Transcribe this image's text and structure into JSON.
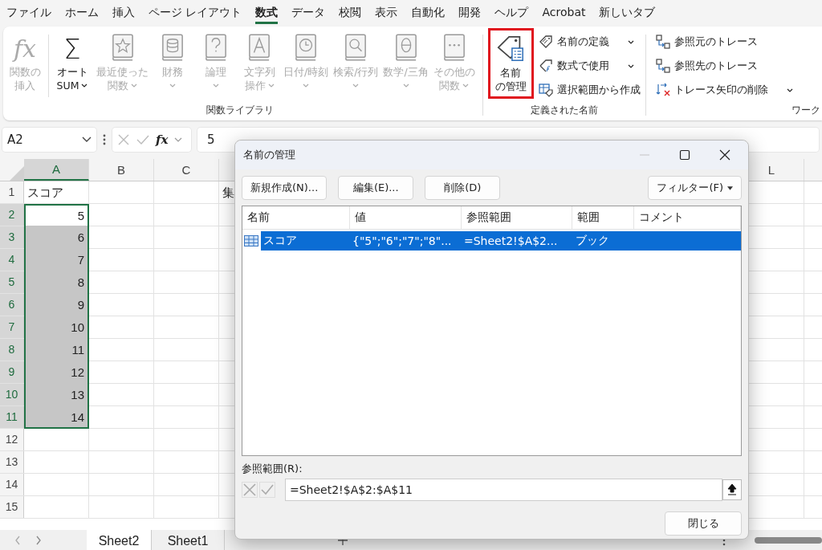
{
  "menu_tabs": [
    {
      "label": "ファイル",
      "selected": false
    },
    {
      "label": "ホーム",
      "selected": false
    },
    {
      "label": "挿入",
      "selected": false
    },
    {
      "label": "ページ レイアウト",
      "selected": false
    },
    {
      "label": "数式",
      "selected": true
    },
    {
      "label": "データ",
      "selected": false
    },
    {
      "label": "校閲",
      "selected": false
    },
    {
      "label": "表示",
      "selected": false
    },
    {
      "label": "自動化",
      "selected": false
    },
    {
      "label": "開発",
      "selected": false
    },
    {
      "label": "ヘルプ",
      "selected": false
    },
    {
      "label": "Acrobat",
      "selected": false
    },
    {
      "label": "新しいタブ",
      "selected": false
    }
  ],
  "ribbon": {
    "function_library": {
      "label": "関数ライブラリ",
      "items": [
        {
          "kind": "fx",
          "symbol": "fx",
          "lines": [
            "関数の",
            "挿入"
          ],
          "disabled": true,
          "dropdown": false
        },
        {
          "kind": "sum",
          "symbol": "Σ",
          "lines": [
            "オート",
            "SUM"
          ],
          "disabled": false,
          "dropdown": true
        },
        {
          "kind": "book",
          "lines": [
            "最近使った",
            "関数"
          ],
          "disabled": true,
          "dropdown": true
        },
        {
          "kind": "book",
          "lines": [
            "財務"
          ],
          "disabled": true,
          "dropdown": true
        },
        {
          "kind": "book",
          "lines": [
            "論理"
          ],
          "disabled": true,
          "dropdown": true
        },
        {
          "kind": "book",
          "lines": [
            "文字列",
            "操作"
          ],
          "disabled": true,
          "dropdown": true
        },
        {
          "kind": "book",
          "lines": [
            "日付/時刻"
          ],
          "disabled": true,
          "dropdown": true
        },
        {
          "kind": "book",
          "lines": [
            "検索/行列"
          ],
          "disabled": true,
          "dropdown": true
        },
        {
          "kind": "book",
          "lines": [
            "数学/三角"
          ],
          "disabled": true,
          "dropdown": true
        },
        {
          "kind": "book",
          "lines": [
            "その他の",
            "関数"
          ],
          "disabled": true,
          "dropdown": true
        }
      ]
    },
    "defined_names": {
      "label": "定義された名前",
      "manager": {
        "lines": [
          "名前",
          "の管理"
        ],
        "highlighted": true
      },
      "items": [
        {
          "label": "名前の定義",
          "dropdown": true
        },
        {
          "label": "数式で使用",
          "dropdown": true
        },
        {
          "label": "選択範囲から作成",
          "dropdown": false
        }
      ]
    },
    "formula_auditing": {
      "label": "ワーク",
      "items": [
        {
          "label": "参照元のトレース",
          "dropdown": false
        },
        {
          "label": "参照先のトレース",
          "dropdown": false
        },
        {
          "label": "トレース矢印の削除",
          "dropdown": true
        }
      ]
    }
  },
  "formula_bar": {
    "name_box": "A2",
    "insert_function": "fx",
    "value": "5"
  },
  "sheet": {
    "columns": [
      {
        "label": "A",
        "selected": true
      },
      {
        "label": "B",
        "selected": false
      },
      {
        "label": "C",
        "selected": false
      },
      {
        "label": "L",
        "selected": false
      }
    ],
    "rows": [
      {
        "number": "1",
        "selected": false,
        "cells": {
          "A": {
            "text": "スコア",
            "kind": "text"
          },
          "D": {
            "text": "集"
          }
        }
      },
      {
        "number": "2",
        "selected": true,
        "cells": {
          "A": {
            "text": "5",
            "kind": "number",
            "active": true
          }
        }
      },
      {
        "number": "3",
        "selected": true,
        "cells": {
          "A": {
            "text": "6",
            "kind": "number",
            "active": false
          }
        }
      },
      {
        "number": "4",
        "selected": true,
        "cells": {
          "A": {
            "text": "7",
            "kind": "number",
            "active": false
          }
        }
      },
      {
        "number": "5",
        "selected": true,
        "cells": {
          "A": {
            "text": "8",
            "kind": "number",
            "active": false
          }
        }
      },
      {
        "number": "6",
        "selected": true,
        "cells": {
          "A": {
            "text": "9",
            "kind": "number",
            "active": false
          }
        }
      },
      {
        "number": "7",
        "selected": true,
        "cells": {
          "A": {
            "text": "10",
            "kind": "number",
            "active": false
          }
        }
      },
      {
        "number": "8",
        "selected": true,
        "cells": {
          "A": {
            "text": "11",
            "kind": "number",
            "active": false
          }
        }
      },
      {
        "number": "9",
        "selected": true,
        "cells": {
          "A": {
            "text": "12",
            "kind": "number",
            "active": false
          }
        }
      },
      {
        "number": "10",
        "selected": true,
        "cells": {
          "A": {
            "text": "13",
            "kind": "number",
            "active": false
          }
        }
      },
      {
        "number": "11",
        "selected": true,
        "cells": {
          "A": {
            "text": "14",
            "kind": "number",
            "active": false
          }
        }
      },
      {
        "number": "12",
        "selected": false,
        "cells": {}
      },
      {
        "number": "13",
        "selected": false,
        "cells": {}
      },
      {
        "number": "14",
        "selected": false,
        "cells": {}
      },
      {
        "number": "15",
        "selected": false,
        "cells": {}
      }
    ]
  },
  "sheet_tabs": [
    {
      "label": "Sheet2",
      "selected": true
    },
    {
      "label": "Sheet1",
      "selected": false
    }
  ],
  "dialog": {
    "title": "名前の管理",
    "buttons": [
      {
        "label": "新規作成(N)..."
      },
      {
        "label": "編集(E)..."
      },
      {
        "label": "削除(D)"
      }
    ],
    "filter": {
      "label": "フィルター(F)"
    },
    "columns": [
      "名前",
      "値",
      "参照範囲",
      "範囲",
      "コメント"
    ],
    "rows": [
      {
        "cells": [
          "スコア",
          "{\"5\";\"6\";\"7\";\"8\"...",
          "=Sheet2!$A$2...",
          "ブック"
        ],
        "selected": true
      }
    ],
    "ref_label": "参照範囲(R):",
    "ref_value": "=Sheet2!$A$2:$A$11",
    "close": "閉じる"
  }
}
